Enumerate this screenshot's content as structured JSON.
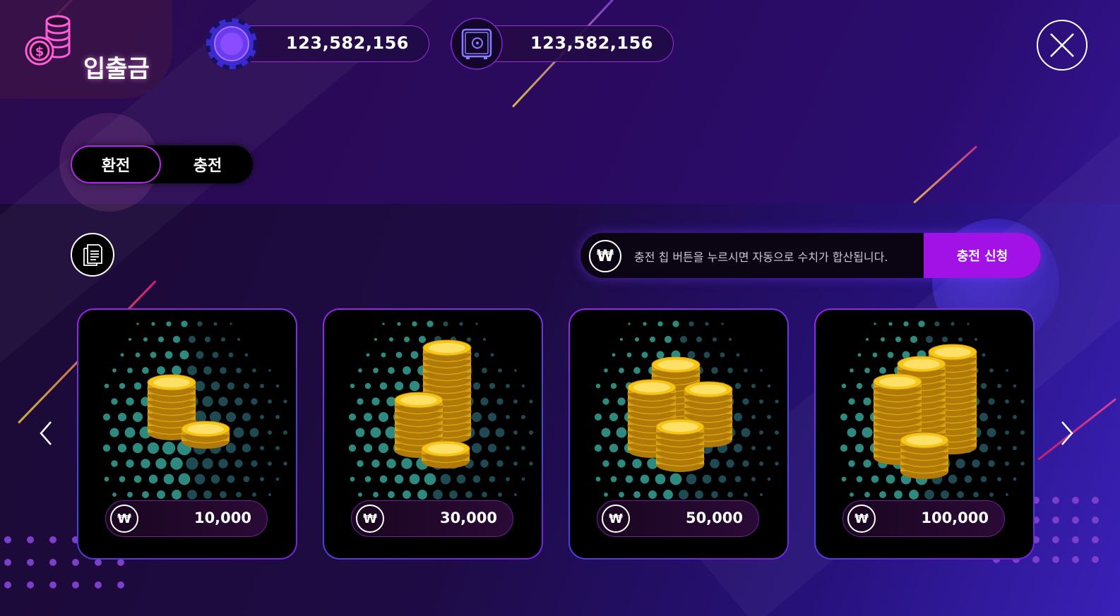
{
  "header": {
    "title": "입출금",
    "balances": [
      {
        "icon": "poker-chip-icon",
        "value": "123,582,156"
      },
      {
        "icon": "safe-icon",
        "value": "123,582,156"
      }
    ],
    "close_icon": "close-icon"
  },
  "tabs": [
    {
      "label": "환전",
      "active": true
    },
    {
      "label": "충전",
      "active": false
    }
  ],
  "charge": {
    "currency_symbol": "₩",
    "message": "충전 칩 버튼을 누르시면 자동으로 수치가 합산됩니다.",
    "submit_label": "충전 신청"
  },
  "packages": [
    {
      "currency_symbol": "₩",
      "amount": "10,000"
    },
    {
      "currency_symbol": "₩",
      "amount": "30,000"
    },
    {
      "currency_symbol": "₩",
      "amount": "50,000"
    },
    {
      "currency_symbol": "₩",
      "amount": "100,000"
    }
  ],
  "colors": {
    "accent": "#a212e6",
    "gold": "#f5c518",
    "dot": "#2e8a7e"
  }
}
